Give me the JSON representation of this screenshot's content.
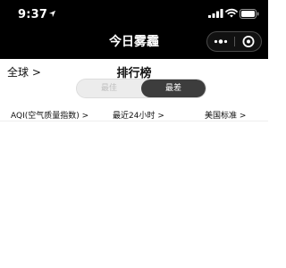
{
  "status_bar": {
    "time": "9:37"
  },
  "nav": {
    "title": "今日雾霾",
    "more_icon": "ellipsis-icon",
    "close_icon": "target-circle-icon"
  },
  "header": {
    "region_label": "全球 >",
    "title": "排行榜"
  },
  "toggle": {
    "options": [
      "最佳",
      "最差"
    ],
    "selected": "最差"
  },
  "filters": {
    "metric": "AQI(空气质量指数) >",
    "period": "最近24小时 >",
    "standard": "美国标准 >"
  },
  "colors": {
    "topbar_bg": "#000000",
    "toggle_active_bg": "#3d3d3d"
  }
}
